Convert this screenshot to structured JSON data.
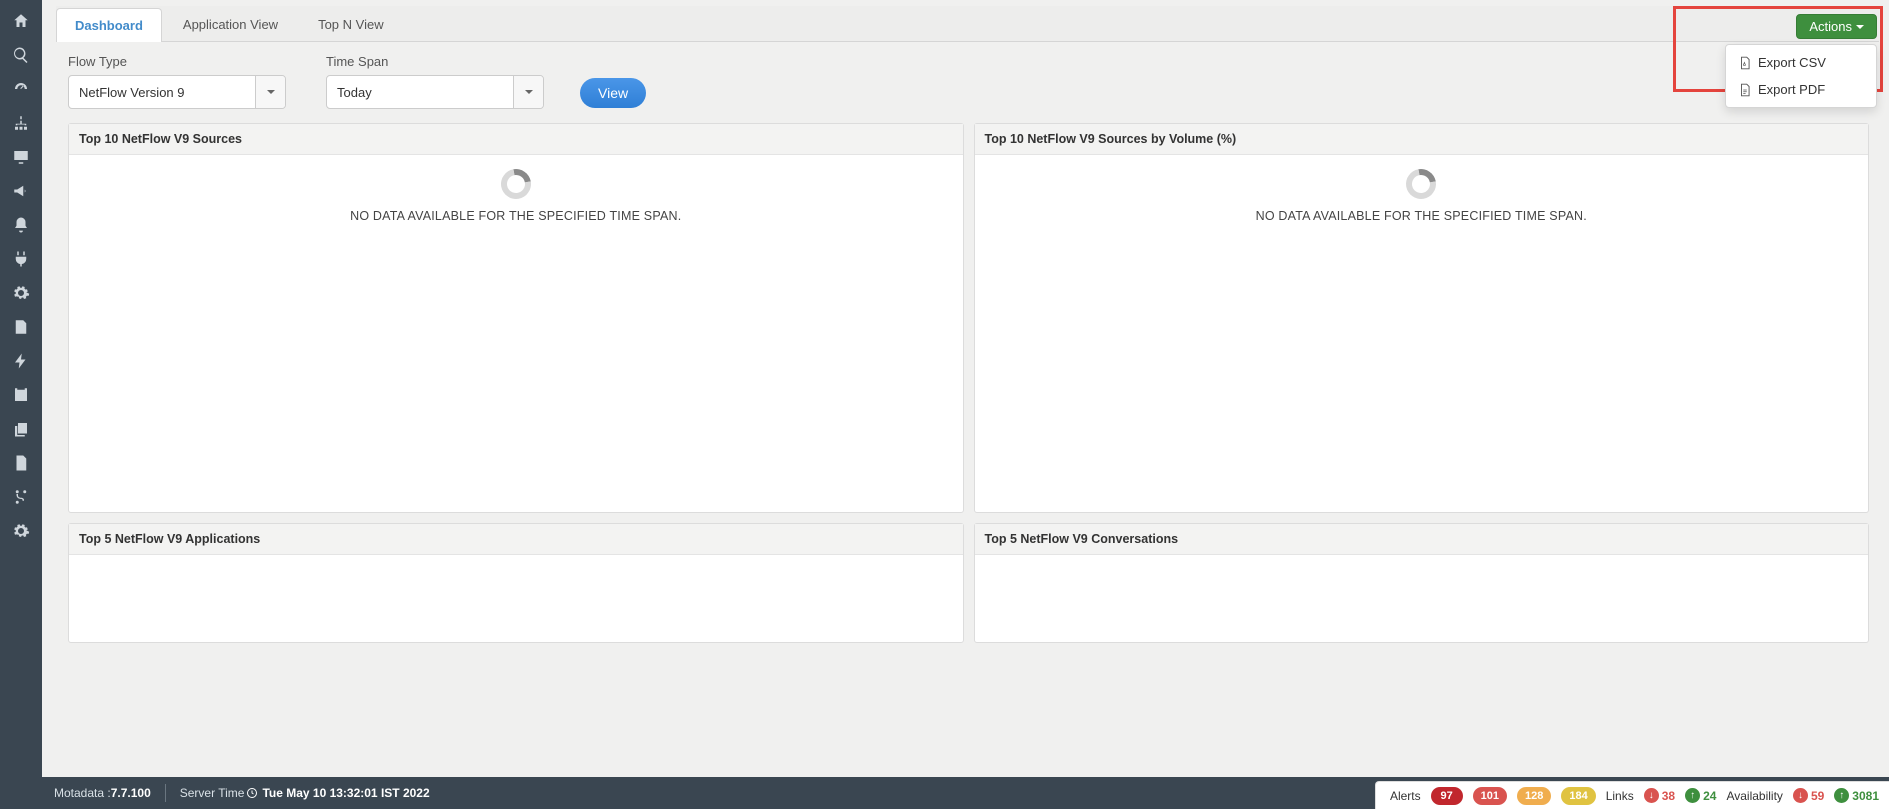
{
  "sidebar": {
    "items": [
      {
        "name": "home-icon"
      },
      {
        "name": "search-icon"
      },
      {
        "name": "dashboard-icon"
      },
      {
        "name": "sitemap-icon"
      },
      {
        "name": "monitor-icon"
      },
      {
        "name": "bullhorn-icon"
      },
      {
        "name": "bell-icon"
      },
      {
        "name": "plug-icon"
      },
      {
        "name": "gears-icon"
      },
      {
        "name": "report-icon"
      },
      {
        "name": "bolt-icon"
      },
      {
        "name": "calendar-icon"
      },
      {
        "name": "copy-icon"
      },
      {
        "name": "file-icon"
      },
      {
        "name": "branch-icon",
        "active": true
      },
      {
        "name": "settings-icon"
      }
    ]
  },
  "tabs": {
    "items": [
      {
        "label": "Dashboard",
        "active": true
      },
      {
        "label": "Application View",
        "active": false
      },
      {
        "label": "Top N View",
        "active": false
      }
    ]
  },
  "actions": {
    "button_label": "Actions",
    "menu": [
      {
        "label": "Export CSV",
        "icon": "csv"
      },
      {
        "label": "Export PDF",
        "icon": "pdf"
      }
    ]
  },
  "filters": {
    "flow_type": {
      "label": "Flow Type",
      "value": "NetFlow Version 9"
    },
    "time_span": {
      "label": "Time Span",
      "value": "Today"
    },
    "view_label": "View"
  },
  "panels": {
    "nodata_text": "NO DATA AVAILABLE FOR THE SPECIFIED TIME SPAN.",
    "items": [
      {
        "title": "Top 10 NetFlow V9 Sources",
        "nodata": true
      },
      {
        "title": "Top 10 NetFlow V9 Sources by Volume (%)",
        "nodata": true
      },
      {
        "title": "Top 5 NetFlow V9 Applications",
        "nodata": false
      },
      {
        "title": "Top 5 NetFlow V9 Conversations",
        "nodata": false
      }
    ]
  },
  "footer": {
    "product_label": "Motadata : ",
    "version": "7.7.100",
    "server_time_label": "Server Time ",
    "server_time": "Tue May 10 13:32:01 IST 2022",
    "alerts_label": "Alerts",
    "alerts": {
      "critical": "97",
      "major": "101",
      "warning": "128",
      "minor": "184"
    },
    "links_label": "Links",
    "links": {
      "down": "38",
      "up": "24"
    },
    "availability_label": "Availability",
    "availability": {
      "down": "59",
      "up": "3081"
    }
  }
}
